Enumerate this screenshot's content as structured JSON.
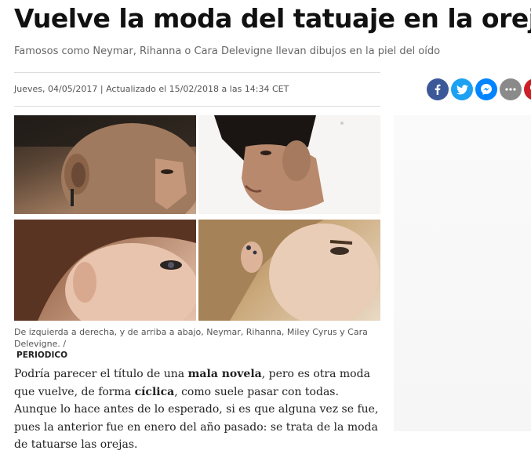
{
  "article": {
    "headline": "Vuelve la moda del tatuaje en la oreja",
    "subheadline": "Famosos como Neymar, Rihanna o Cara Delevigne llevan dibujos en la piel del oído",
    "date_line": "Jueves, 04/05/2017 | Actualizado el 15/02/2018 a las 14:34 CET",
    "caption": "De izquierda a derecha, y de arriba a abajo, Neymar, Rihanna, Miley Cyrus y Cara Delevigne. /",
    "credit": "PERIODICO",
    "body": {
      "t1": "Podría parecer el título de una ",
      "b1": "mala novela",
      "t2": ", pero es otra moda que vuelve, de forma ",
      "b2": "cíclica",
      "t3": ", como suele pasar con todas. Aunque lo hace antes de lo esperado, si es que alguna vez se fue, pues la anterior fue en enero del año pasado: se trata de la moda de tatuarse las orejas."
    }
  },
  "share": {
    "colors": {
      "facebook": "#3b5998",
      "twitter": "#1da1f2",
      "messenger": "#0084ff",
      "more": "#8a8a8a",
      "pinterest": "#cb2027"
    },
    "icons": [
      "facebook-icon",
      "twitter-icon",
      "messenger-icon",
      "more-icon",
      "pinterest-icon"
    ]
  }
}
